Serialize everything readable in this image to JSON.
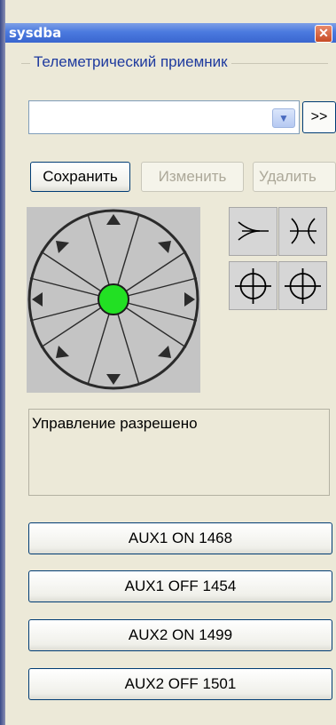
{
  "window": {
    "title": "sysdba",
    "close_glyph": "✕"
  },
  "group": {
    "title": "Телеметрический приемник"
  },
  "combo": {
    "value": "",
    "expand_label": ">>"
  },
  "actions": {
    "save": "Сохранить",
    "edit": "Изменить",
    "delete": "Удалить"
  },
  "ptz": {
    "center_color": "#22e023",
    "directions": [
      "up",
      "up-right",
      "right",
      "down-right",
      "down",
      "down-left",
      "left",
      "up-left"
    ]
  },
  "tools": [
    "zoom-in-icon",
    "zoom-out-icon",
    "focus-near-icon",
    "focus-far-icon"
  ],
  "status": {
    "text": "Управление разрешено"
  },
  "aux_buttons": [
    {
      "label": "AUX1 ON 1468"
    },
    {
      "label": "AUX1 OFF 1454"
    },
    {
      "label": "AUX2 ON 1499"
    },
    {
      "label": "AUX2 OFF 1501"
    }
  ]
}
